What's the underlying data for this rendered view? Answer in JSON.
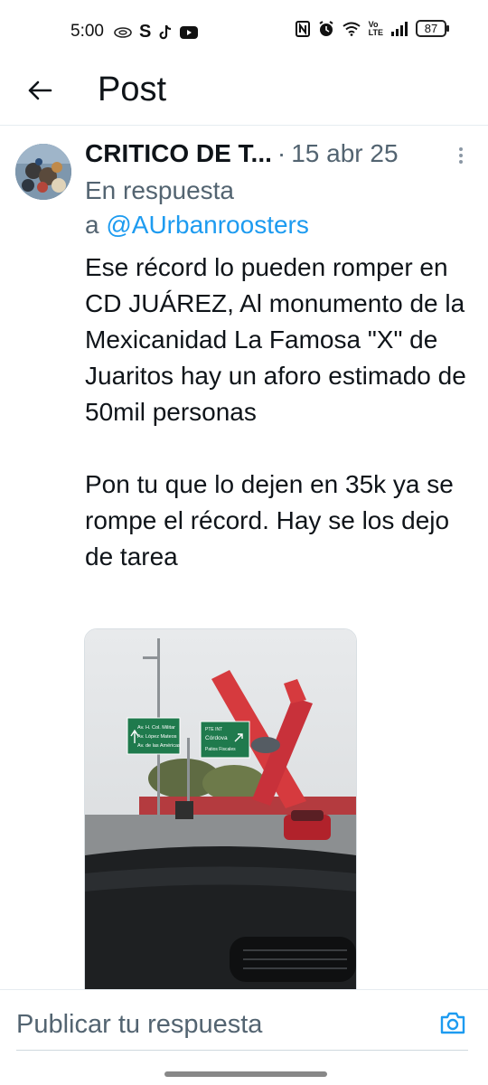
{
  "status_bar": {
    "time": "5:00",
    "left_icons": [
      "cloud-sync-icon",
      "s-app-icon",
      "tiktok-icon",
      "youtube-icon"
    ],
    "right_icons": [
      "nfc-icon",
      "alarm-icon",
      "wifi-icon",
      "volte-icon",
      "signal-icon"
    ],
    "volte_label": "Vo\nLTE",
    "battery": "87"
  },
  "header": {
    "title": "Post"
  },
  "post": {
    "author": "CRITICO DE T...",
    "separator": "·",
    "date": "15 abr 25",
    "reply_prefix": "En respuesta",
    "reply_a": "a ",
    "reply_handle": "@AUrbanroosters",
    "text": "Ese récord lo pueden romper en CD JUÁREZ, Al monumento de la Mexicanidad La Famosa \"X\" de Juaritos hay un aforo estimado de 50mil personas\n\nPon tu que lo dejen en 35k ya se rompe el récord. Hay se los dejo  de tarea",
    "media": {
      "sign_left_lines": [
        "Av. H. Col. Militar",
        "Av. López Mateos",
        "Av. de las Américas"
      ],
      "sign_right_lines": [
        "PTE INT",
        "Córdova",
        "Patios Fiscales"
      ]
    }
  },
  "reply_bar": {
    "placeholder": "Publicar tu respuesta"
  },
  "colors": {
    "accent": "#1d9bf0",
    "text_primary": "#0f1419",
    "text_secondary": "#536471"
  }
}
